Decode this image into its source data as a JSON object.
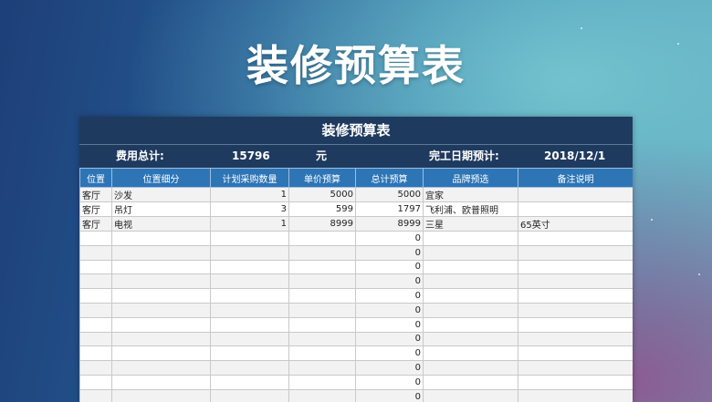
{
  "slide": {
    "title": "装修预算表"
  },
  "sheet": {
    "title": "装修预算表",
    "summary": {
      "total_label": "费用总计:",
      "total_value": "15796",
      "unit": "元",
      "date_label": "完工日期预计:",
      "date_value": "2018/12/1"
    },
    "columns": [
      "位置",
      "位置细分",
      "计划采购数量",
      "单价预算",
      "总计预算",
      "品牌预选",
      "备注说明"
    ],
    "rows": [
      [
        "客厅",
        "沙发",
        "1",
        "5000",
        "5000",
        "宜家",
        ""
      ],
      [
        "客厅",
        "吊灯",
        "3",
        "599",
        "1797",
        "飞利浦、欧普照明",
        ""
      ],
      [
        "客厅",
        "电视",
        "1",
        "8999",
        "8999",
        "三星",
        "65英寸"
      ],
      [
        "",
        "",
        "",
        "",
        "0",
        "",
        ""
      ],
      [
        "",
        "",
        "",
        "",
        "0",
        "",
        ""
      ],
      [
        "",
        "",
        "",
        "",
        "0",
        "",
        ""
      ],
      [
        "",
        "",
        "",
        "",
        "0",
        "",
        ""
      ],
      [
        "",
        "",
        "",
        "",
        "0",
        "",
        ""
      ],
      [
        "",
        "",
        "",
        "",
        "0",
        "",
        ""
      ],
      [
        "",
        "",
        "",
        "",
        "0",
        "",
        ""
      ],
      [
        "",
        "",
        "",
        "",
        "0",
        "",
        ""
      ],
      [
        "",
        "",
        "",
        "",
        "0",
        "",
        ""
      ],
      [
        "",
        "",
        "",
        "",
        "0",
        "",
        ""
      ],
      [
        "",
        "",
        "",
        "",
        "0",
        "",
        ""
      ],
      [
        "",
        "",
        "",
        "",
        "0",
        "",
        ""
      ]
    ]
  }
}
